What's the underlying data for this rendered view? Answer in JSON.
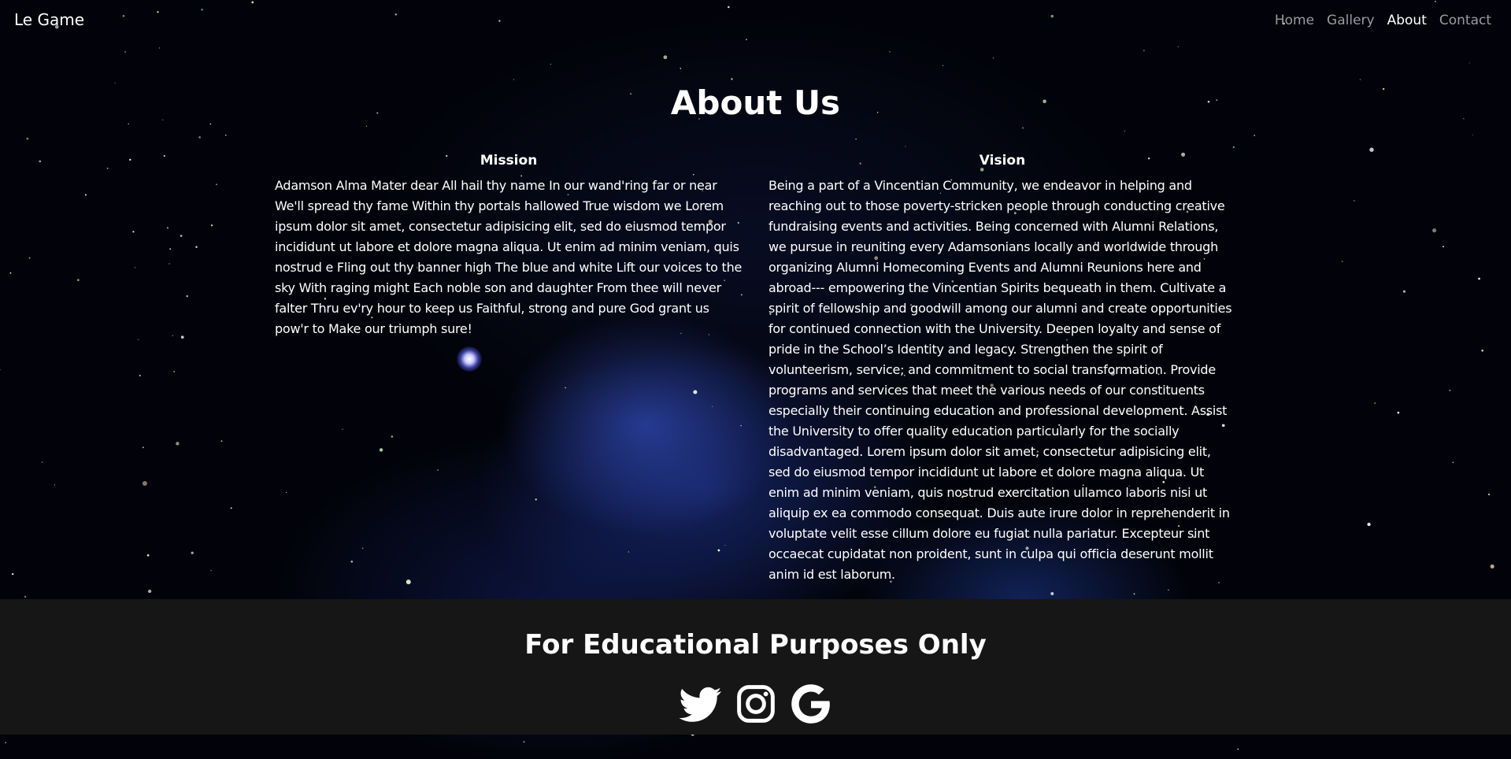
{
  "nav": {
    "brand": "Le Game",
    "links": [
      {
        "label": "Home",
        "active": false
      },
      {
        "label": "Gallery",
        "active": false
      },
      {
        "label": "About",
        "active": true
      },
      {
        "label": "Contact",
        "active": false
      }
    ]
  },
  "page_title": "About Us",
  "mission": {
    "heading": "Mission",
    "text": "Adamson Alma Mater dear All hail thy name In our wand'ring far or near We'll spread thy fame Within thy portals hallowed True wisdom we Lorem ipsum dolor sit amet, consectetur adipisicing elit, sed do eiusmod tempor incididunt ut labore et dolore magna aliqua. Ut enim ad minim veniam, quis nostrud e Fling out thy banner high The blue and white Lift our voices to the sky With raging might Each noble son and daughter From thee will never falter Thru ev'ry hour to keep us Faithful, strong and pure God grant us pow'r to Make our triumph sure!"
  },
  "vision": {
    "heading": "Vision",
    "text": "Being a part of a Vincentian Community, we endeavor in helping and reaching out to those poverty-stricken people through conducting creative fundraising events and activities. Being concerned with Alumni Relations, we pursue in reuniting every Adamsonians locally and worldwide through organizing Alumni Homecoming Events and Alumni Reunions here and abroad--- empowering the Vincentian Spirits bequeath in them. Cultivate a spirit of fellowship and goodwill among our alumni and create opportunities for continued connection with the University. Deepen loyalty and sense of pride in the School’s Identity and legacy. Strengthen the spirit of volunteerism, service; and commitment to social transformation. Provide programs and services that meet the various needs of our constituents especially their continuing education and professional development. Assist the University to offer quality education particularly for the socially disadvantaged. Lorem ipsum dolor sit amet, consectetur adipisicing elit, sed do eiusmod tempor incididunt ut labore et dolore magna aliqua. Ut enim ad minim veniam, quis nostrud exercitation ullamco laboris nisi ut aliquip ex ea commodo consequat. Duis aute irure dolor in reprehenderit in voluptate velit esse cillum dolore eu fugiat nulla pariatur. Excepteur sint occaecat cupidatat non proident, sunt in culpa qui officia deserunt mollit anim id est laborum."
  },
  "footer": {
    "text": "For Educational Purposes Only",
    "social_icons": [
      "twitter-icon",
      "instagram-icon",
      "google-icon"
    ]
  },
  "colors": {
    "nav_inactive": "#9b9b9b",
    "nav_active": "#ffffff",
    "footer_bg": "#161616",
    "text": "#ffffff"
  }
}
